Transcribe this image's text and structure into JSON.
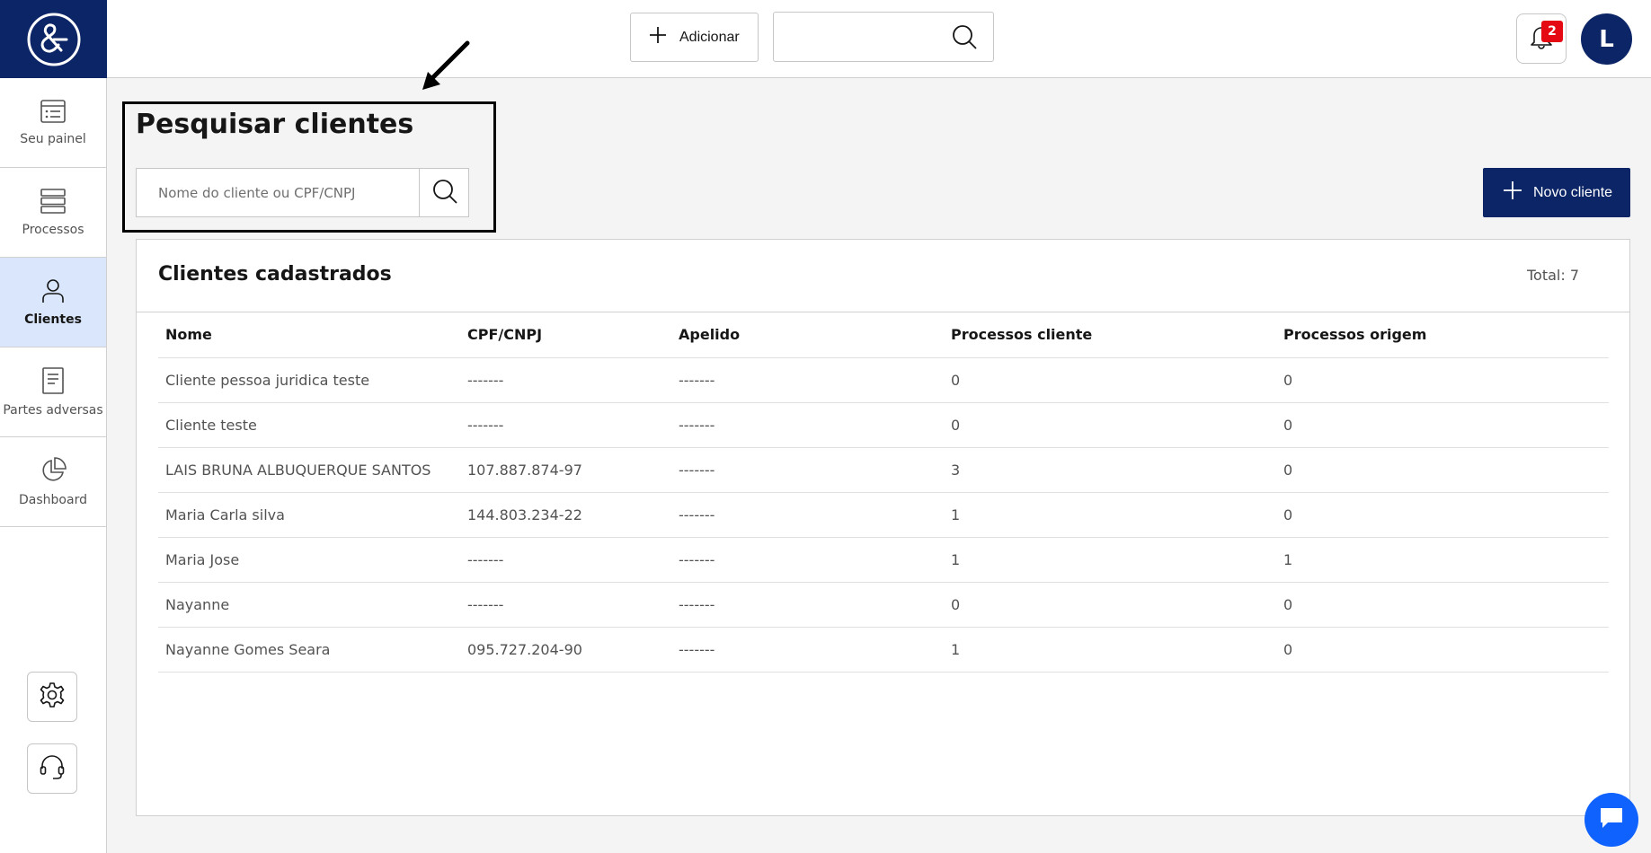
{
  "brand": {
    "logo_color": "#0b2566",
    "accent": "#0f62fe"
  },
  "sidebar": {
    "items": [
      {
        "label": "Seu painel",
        "icon": "list-icon",
        "active": false
      },
      {
        "label": "Processos",
        "icon": "stack-icon",
        "active": false
      },
      {
        "label": "Clientes",
        "icon": "user-icon",
        "active": true
      },
      {
        "label": "Partes adversas",
        "icon": "document-icon",
        "active": false
      },
      {
        "label": "Dashboard",
        "icon": "pie-chart-icon",
        "active": false
      }
    ],
    "settings_icon": "gear-icon",
    "support_icon": "headset-icon"
  },
  "topbar": {
    "add_label": "Adicionar",
    "search_placeholder": "",
    "notifications_count": "2",
    "avatar_initial": "L"
  },
  "search": {
    "title": "Pesquisar clientes",
    "placeholder": "Nome do cliente ou CPF/CNPJ"
  },
  "new_client_label": "Novo cliente",
  "clients": {
    "title": "Clientes cadastrados",
    "total": "Total: 7",
    "columns": [
      "Nome",
      "CPF/CNPJ",
      "Apelido",
      "Processos cliente",
      "Processos origem"
    ],
    "rows": [
      [
        "Cliente pessoa juridica teste",
        "-------",
        "-------",
        "0",
        "0"
      ],
      [
        "Cliente teste",
        "-------",
        "-------",
        "0",
        "0"
      ],
      [
        "LAIS BRUNA ALBUQUERQUE SANTOS",
        "107.887.874-97",
        "-------",
        "3",
        "0"
      ],
      [
        "Maria Carla silva",
        "144.803.234-22",
        "-------",
        "1",
        "0"
      ],
      [
        "Maria Jose",
        "-------",
        "-------",
        "1",
        "1"
      ],
      [
        "Nayanne",
        "-------",
        "-------",
        "0",
        "0"
      ],
      [
        "Nayanne Gomes Seara",
        "095.727.204-90",
        "-------",
        "1",
        "0"
      ]
    ]
  }
}
